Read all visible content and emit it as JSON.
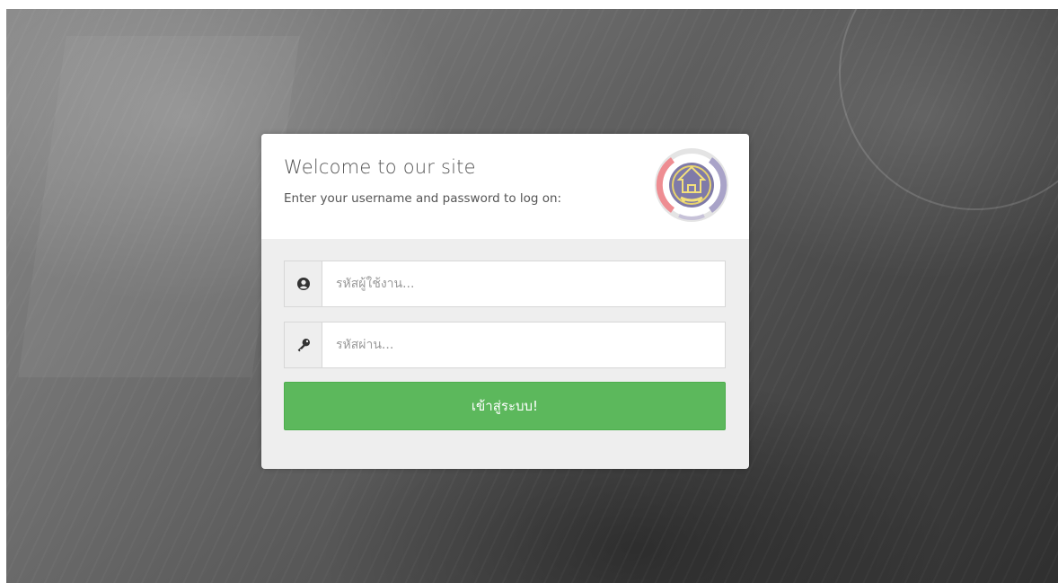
{
  "login": {
    "title": "Welcome to our site",
    "subtitle": "Enter your username and password to log on:",
    "logo_icon": "seal-logo-icon",
    "username": {
      "icon": "user-icon",
      "placeholder": "รหัสผู้ใช้งาน...",
      "value": ""
    },
    "password": {
      "icon": "key-icon",
      "placeholder": "รหัสผ่าน...",
      "value": ""
    },
    "submit_label": "เข้าสู่ระบบ!"
  },
  "colors": {
    "submit_button": "#5cb85c",
    "panel_header": "#ffffff",
    "panel_body": "#eeeeee",
    "background": "#555555"
  }
}
